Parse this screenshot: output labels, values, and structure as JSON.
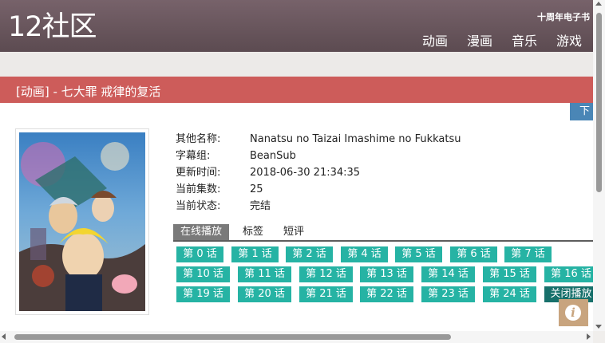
{
  "site": {
    "logo": "12社区",
    "anniversary_link": "十周年电子书"
  },
  "nav": [
    {
      "label": "动画"
    },
    {
      "label": "漫画"
    },
    {
      "label": "音乐"
    },
    {
      "label": "游戏"
    }
  ],
  "title": "[动画] - 七大罪 戒律的复活",
  "download_label": "下载",
  "info": [
    {
      "label": "其他名称:",
      "value": "Nanatsu no Taizai Imashime no Fukkatsu"
    },
    {
      "label": "字幕组:",
      "value": "BeanSub"
    },
    {
      "label": "更新时间:",
      "value": "2018-06-30 21:34:35"
    },
    {
      "label": "当前集数:",
      "value": "25"
    },
    {
      "label": "当前状态:",
      "value": "完结"
    }
  ],
  "tabs": [
    {
      "label": "在线播放",
      "active": true
    },
    {
      "label": "标签"
    },
    {
      "label": "短评"
    }
  ],
  "episodes": [
    "第 0 话",
    "第 1 话",
    "第 2 话",
    "第 4 话",
    "第 5 话",
    "第 6 话",
    "第 7 话",
    "第 10 话",
    "第 11 话",
    "第 12 话",
    "第 13 话",
    "第 14 话",
    "第 15 话",
    "第 16 话",
    "第 19 话",
    "第 20 话",
    "第 21 话",
    "第 22 话",
    "第 23 话",
    "第 24 话"
  ],
  "close_player_label": "关闭播放",
  "info_button_icon": "info-icon",
  "colors": {
    "header": "#6b575e",
    "title_bar": "#cd5c5a",
    "episode": "#26b3a4",
    "download": "#4a86b6",
    "info_button": "#c8a47e"
  }
}
